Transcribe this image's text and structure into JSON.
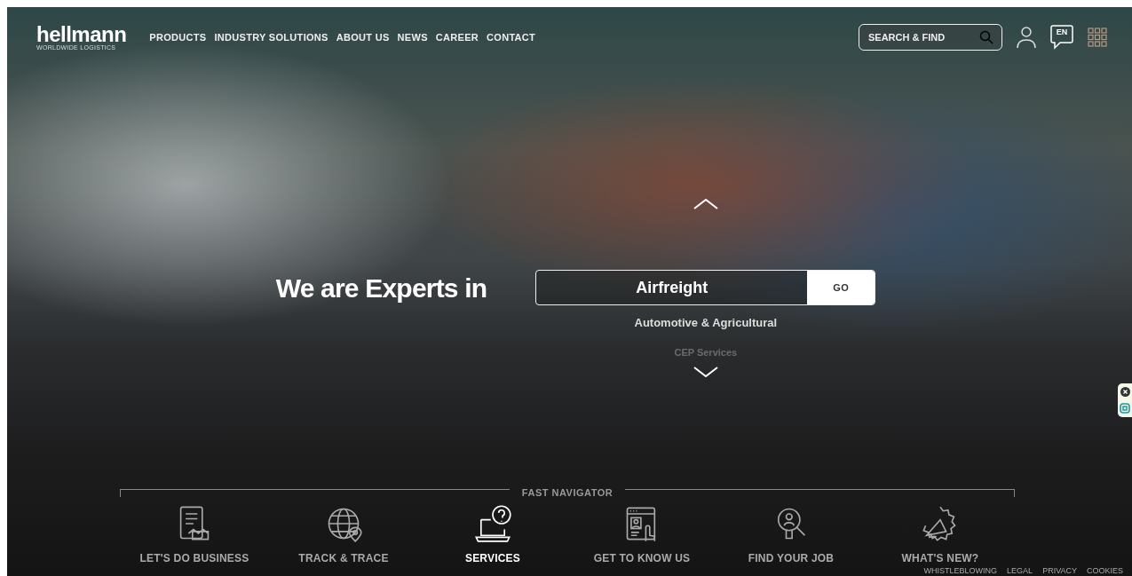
{
  "header": {
    "logo": "hellmann",
    "logo_tagline": "WORLDWIDE LOGISTICS",
    "menu": [
      {
        "label": "PRODUCTS"
      },
      {
        "label": "INDUSTRY SOLUTIONS"
      },
      {
        "label": "ABOUT US"
      },
      {
        "label": "NEWS"
      },
      {
        "label": "CAREER"
      },
      {
        "label": "CONTACT"
      }
    ],
    "search": {
      "placeholder": "SEARCH & FIND"
    },
    "language": "EN"
  },
  "hero": {
    "title": "We are Experts in",
    "button": "GO",
    "phrases": [
      {
        "text": "Airfreight",
        "selected": true
      },
      {
        "text": "Automotive & Agricultural",
        "selected": false
      },
      {
        "text": "CEP Services",
        "selected": false
      }
    ]
  },
  "fast_navigator": {
    "title": "FAST NAVIGATOR",
    "items": [
      {
        "label": "LET'S DO BUSINESS",
        "kind": "business",
        "selected": false
      },
      {
        "label": "TRACK & TRACE",
        "kind": "track",
        "selected": false
      },
      {
        "label": "SERVICES",
        "kind": "services",
        "selected": true
      },
      {
        "label": "GET TO KNOW US",
        "kind": "about",
        "selected": false
      },
      {
        "label": "FIND YOUR JOB",
        "kind": "job",
        "selected": false
      },
      {
        "label": "WHAT'S NEW?",
        "kind": "news",
        "selected": false
      }
    ]
  },
  "footer_links": [
    "WHISTLEBLOWING",
    "LEGAL",
    "PRIVACY",
    "COOKIES"
  ]
}
